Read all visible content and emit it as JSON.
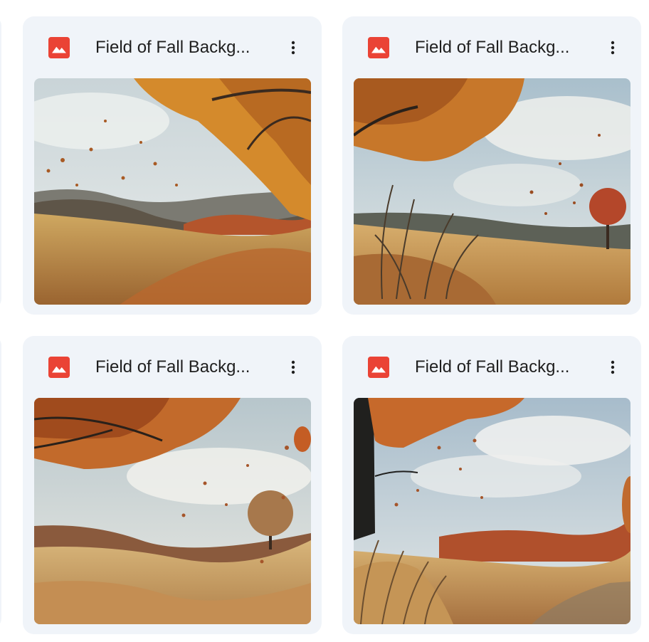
{
  "colors": {
    "card_bg": "#f0f4f9",
    "image_icon": "#ea4335",
    "text": "#1f1f1f"
  },
  "files": [
    {
      "name": "Field of Fall Backg...",
      "icon": "image-file-icon",
      "menu_icon": "more-vert-icon"
    },
    {
      "name": "Field of Fall Backg...",
      "icon": "image-file-icon",
      "menu_icon": "more-vert-icon"
    },
    {
      "name": "Field of Fall Backg...",
      "icon": "image-file-icon",
      "menu_icon": "more-vert-icon"
    },
    {
      "name": "Field of Fall Backg...",
      "icon": "image-file-icon",
      "menu_icon": "more-vert-icon"
    }
  ]
}
